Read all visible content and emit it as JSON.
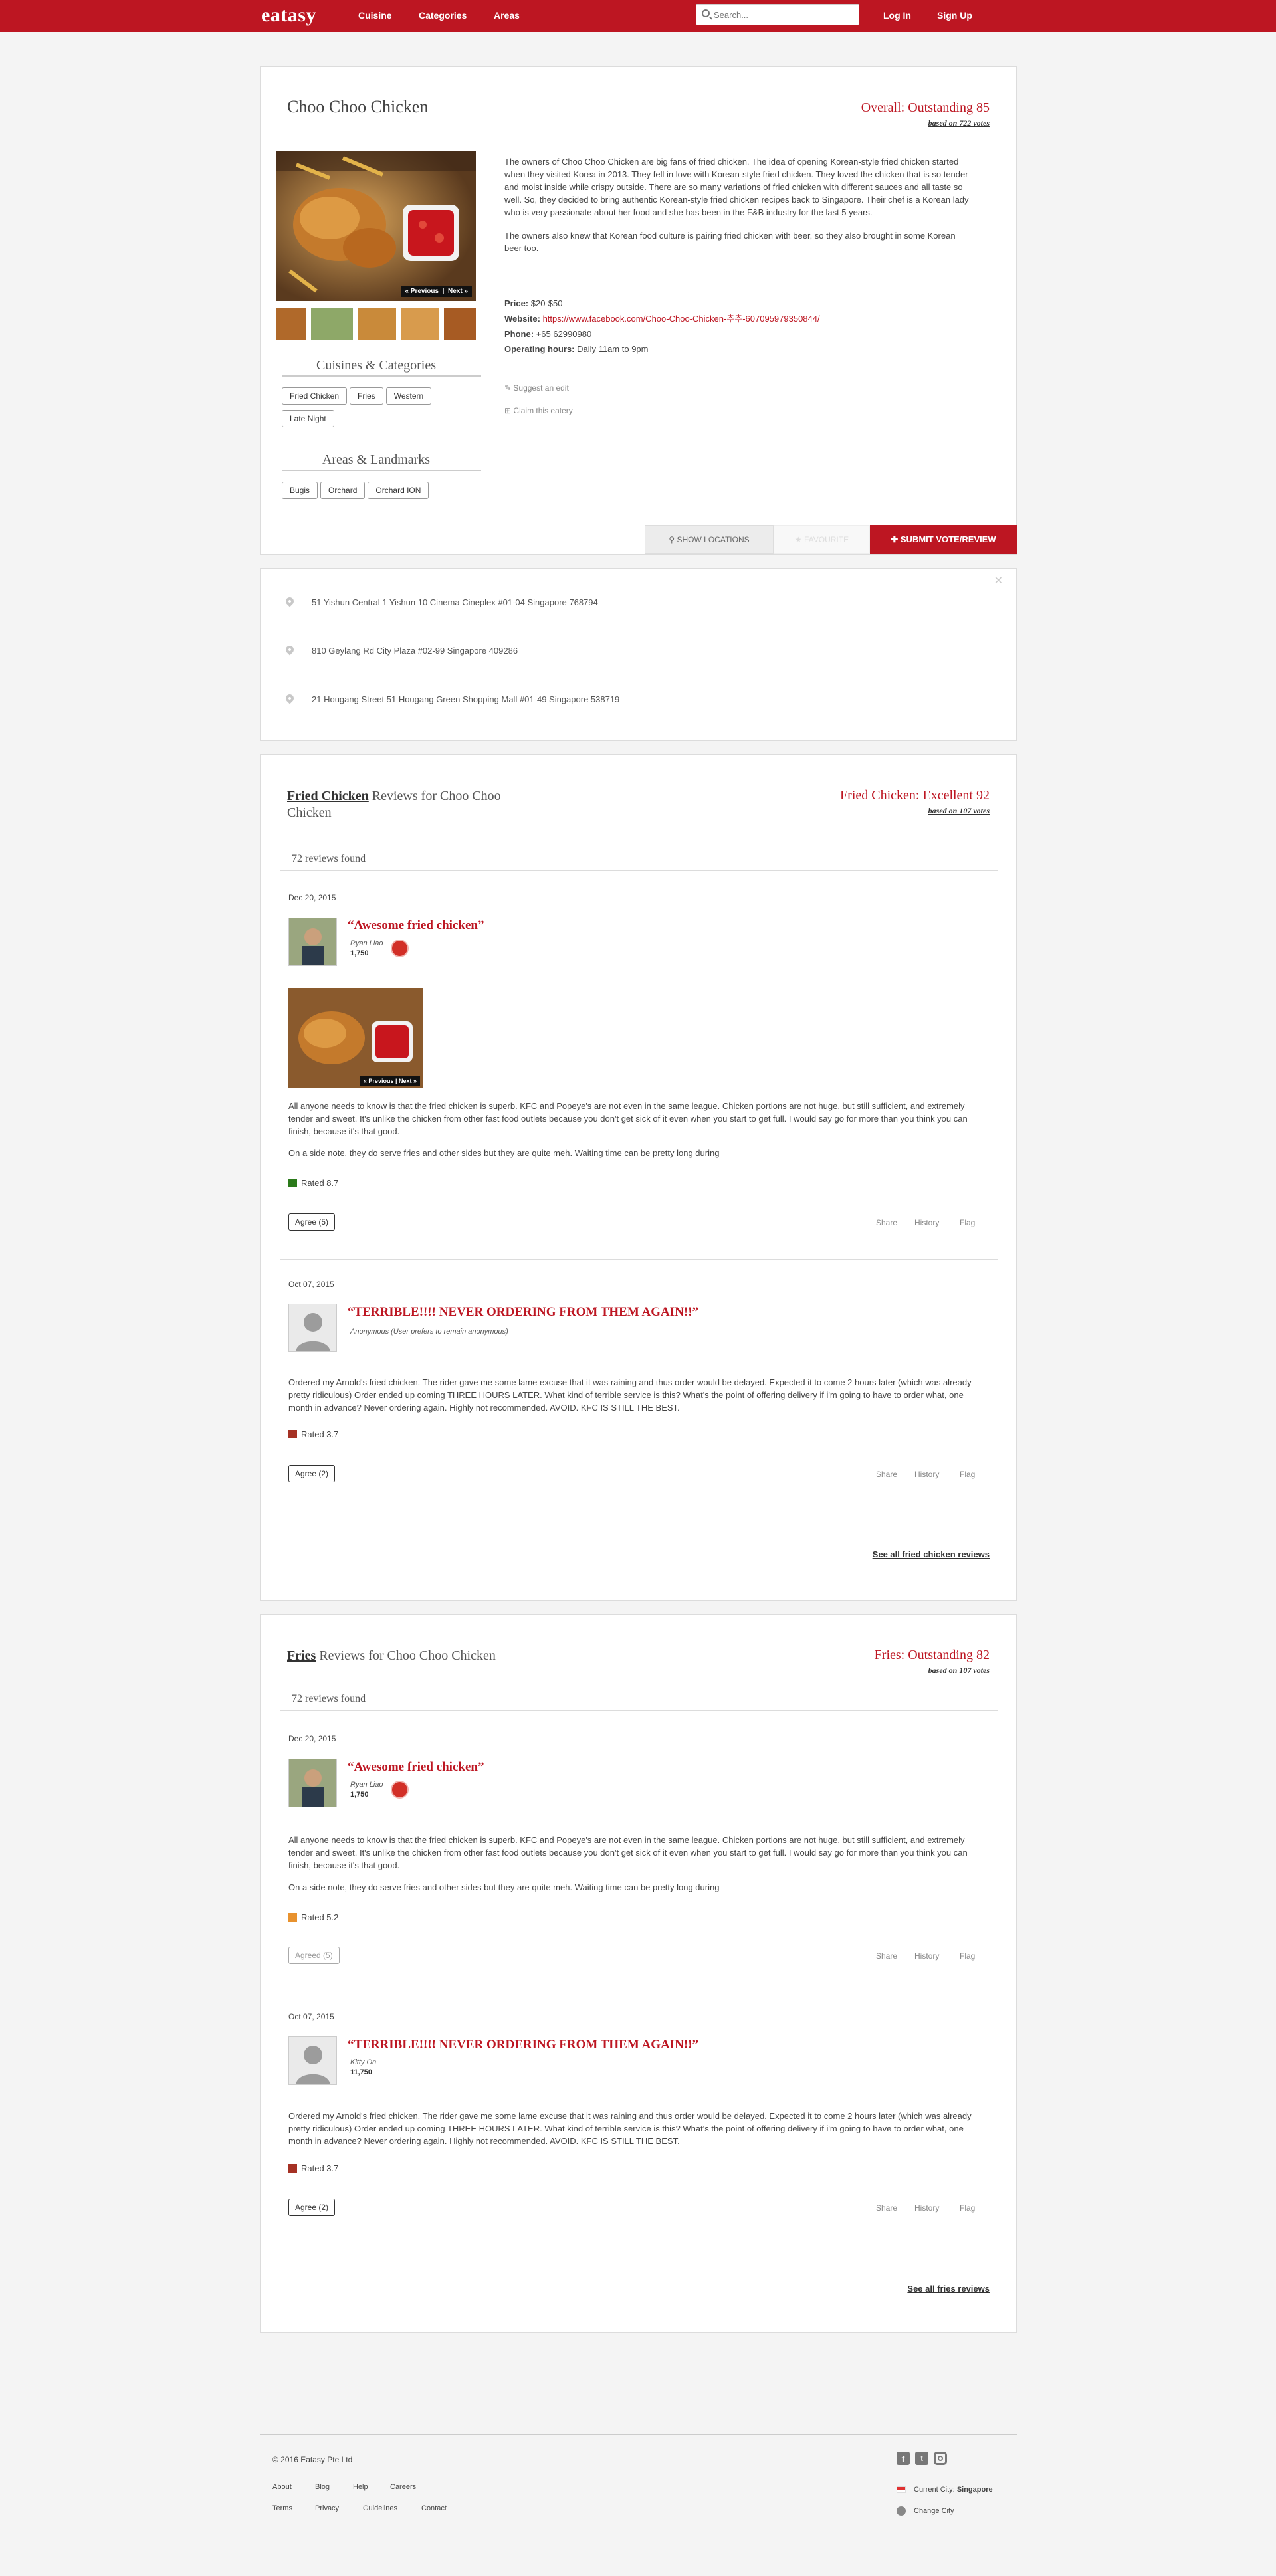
{
  "nav": {
    "logo": "eatasy",
    "links": [
      "Cuisine",
      "Categories",
      "Areas"
    ],
    "search_placeholder": "Search...",
    "login": "Log In",
    "signup": "Sign Up"
  },
  "restaurant": {
    "name": "Choo Choo Chicken",
    "overall": "Overall: Outstanding 85",
    "overall_votes": "based on 722 votes",
    "photo_prev": "« Previous",
    "photo_next": "Next »",
    "description": [
      "The owners of Choo Choo Chicken are big fans of fried chicken. The idea of opening Korean-style fried chicken started when they visited Korea in 2013. They fell in love with Korean-style fried chicken. They loved the chicken that is so tender and moist inside while crispy outside. There are so many variations of fried chicken with different sauces and all taste so well. So, they decided to bring authentic Korean-style fried chicken recipes back to Singapore. Their chef is a Korean lady who is very passionate about her food and she has been in the F&B industry for the last 5 years.",
      "The owners also knew that Korean food culture is pairing fried chicken with beer, so they also brought in some Korean beer too."
    ],
    "price_label": "Price:",
    "price": "$20-$50",
    "website_label": "Website:",
    "website": "https://www.facebook.com/Choo-Choo-Chicken-추추-607095979350844/",
    "phone_label": "Phone:",
    "phone": "+65 62990980",
    "hours_label": "Operating hours:",
    "hours": "Daily 11am to 9pm",
    "suggest_edit": "Suggest an edit",
    "claim": "Claim this eatery",
    "cuisines_heading": "Cuisines & Categories",
    "cuisines": [
      "Fried Chicken",
      "Fries",
      "Western",
      "Late Night"
    ],
    "areas_heading": "Areas & Landmarks",
    "areas": [
      "Bugis",
      "Orchard",
      "Orchard ION"
    ],
    "show_locations": "SHOW LOCATIONS",
    "favourite": "FAVOURITE",
    "submit": "SUBMIT VOTE/REVIEW"
  },
  "locations": [
    "51 Yishun Central 1 Yishun 10 Cinema Cineplex #01-04 Singapore 768794",
    "810 Geylang Rd City Plaza #02-99 Singapore 409286",
    "21 Hougang Street 51 Hougang Green Shopping Mall #01-49 Singapore 538719"
  ],
  "sections": [
    {
      "category": "Fried Chicken",
      "suffix": " Reviews for Choo Choo Chicken",
      "score": "Fried Chicken: Excellent 92",
      "votes": "based on 107 votes",
      "found": "72 reviews found",
      "see_all": "See all fried chicken reviews",
      "reviews": [
        {
          "date": "Dec 20, 2015",
          "title": "“Awesome fried chicken”",
          "user": "Ryan Liao",
          "points": "1,750",
          "text": [
            "All anyone needs to know is that the fried chicken is superb. KFC and Popeye's are not even in the same league. Chicken portions are not huge, but still sufficient, and extremely tender and sweet. It's unlike the chicken from other fast food outlets because you don't get sick of it even when you start to get full. I would say go for more than you think you can finish, because it's that good.",
            "On a side note, they do serve fries and other sides but they are quite meh. Waiting time can be pretty long during"
          ],
          "rated": "Rated 8.7",
          "rated_color": "#2b7a1a",
          "agree": "Agree (5)",
          "share": "Share",
          "history": "History",
          "flag": "Flag",
          "photo_prev": "« Previous",
          "photo_next": "Next »"
        },
        {
          "date": "Oct 07, 2015",
          "title": "“TERRIBLE!!!! NEVER ORDERING FROM THEM AGAIN!!”",
          "user": "Anonymous (User prefers to remain anonymous)",
          "points": "",
          "text": [
            "Ordered my Arnold's fried chicken. The rider gave me some lame excuse that it was raining and thus order would be delayed. Expected it to come 2 hours later (which was already pretty ridiculous) Order ended up coming THREE HOURS LATER. What kind of terrible service is this? What's the point of offering delivery if i'm going to have to order what, one month in advance? Never ordering again. Highly not recommended. AVOID. KFC IS STILL THE BEST."
          ],
          "rated": "Rated 3.7",
          "rated_color": "#a53124",
          "agree": "Agree (2)",
          "share": "Share",
          "history": "History",
          "flag": "Flag"
        }
      ]
    },
    {
      "category": "Fries",
      "suffix": " Reviews for Choo Choo Chicken",
      "score": "Fries: Outstanding 82",
      "votes": "based on 107 votes",
      "found": "72 reviews found",
      "see_all": "See all fries reviews",
      "reviews": [
        {
          "date": "Dec 20, 2015",
          "title": "“Awesome fried chicken”",
          "user": "Ryan Liao",
          "points": "1,750",
          "text": [
            "All anyone needs to know is that the fried chicken is superb. KFC and Popeye's are not even in the same league. Chicken portions are not huge, but still sufficient, and extremely tender and sweet. It's unlike the chicken from other fast food outlets because you don't get sick of it even when you start to get full. I would say go for more than you think you can finish, because it's that good.",
            "On a side note, they do serve fries and other sides but they are quite meh. Waiting time can be pretty long during"
          ],
          "rated": "Rated 5.2",
          "rated_color": "#e8922e",
          "agree": "Agreed (5)",
          "share": "Share",
          "history": "History",
          "flag": "Flag"
        },
        {
          "date": "Oct 07, 2015",
          "title": "“TERRIBLE!!!! NEVER ORDERING FROM THEM AGAIN!!”",
          "user": "Kitty On",
          "points": "11,750",
          "text": [
            "Ordered my Arnold's fried chicken. The rider gave me some lame excuse that it was raining and thus order would be delayed. Expected it to come 2 hours later (which was already pretty ridiculous) Order ended up coming THREE HOURS LATER. What kind of terrible service is this? What's the point of offering delivery if i'm going to have to order what, one month in advance? Never ordering again. Highly not recommended. AVOID. KFC IS STILL THE BEST."
          ],
          "rated": "Rated 3.7",
          "rated_color": "#a53124",
          "agree": "Agree (2)",
          "share": "Share",
          "history": "History",
          "flag": "Flag"
        }
      ]
    }
  ],
  "footer": {
    "copyright": "© 2016 Eatasy Pte Ltd",
    "links1": [
      "About",
      "Blog",
      "Help",
      "Careers"
    ],
    "links2": [
      "Terms",
      "Privacy",
      "Guidelines",
      "Contact"
    ],
    "city_label": "Current City:",
    "city": "Singapore",
    "change_city": "Change City"
  },
  "colors": {
    "brand": "#bd1622"
  }
}
